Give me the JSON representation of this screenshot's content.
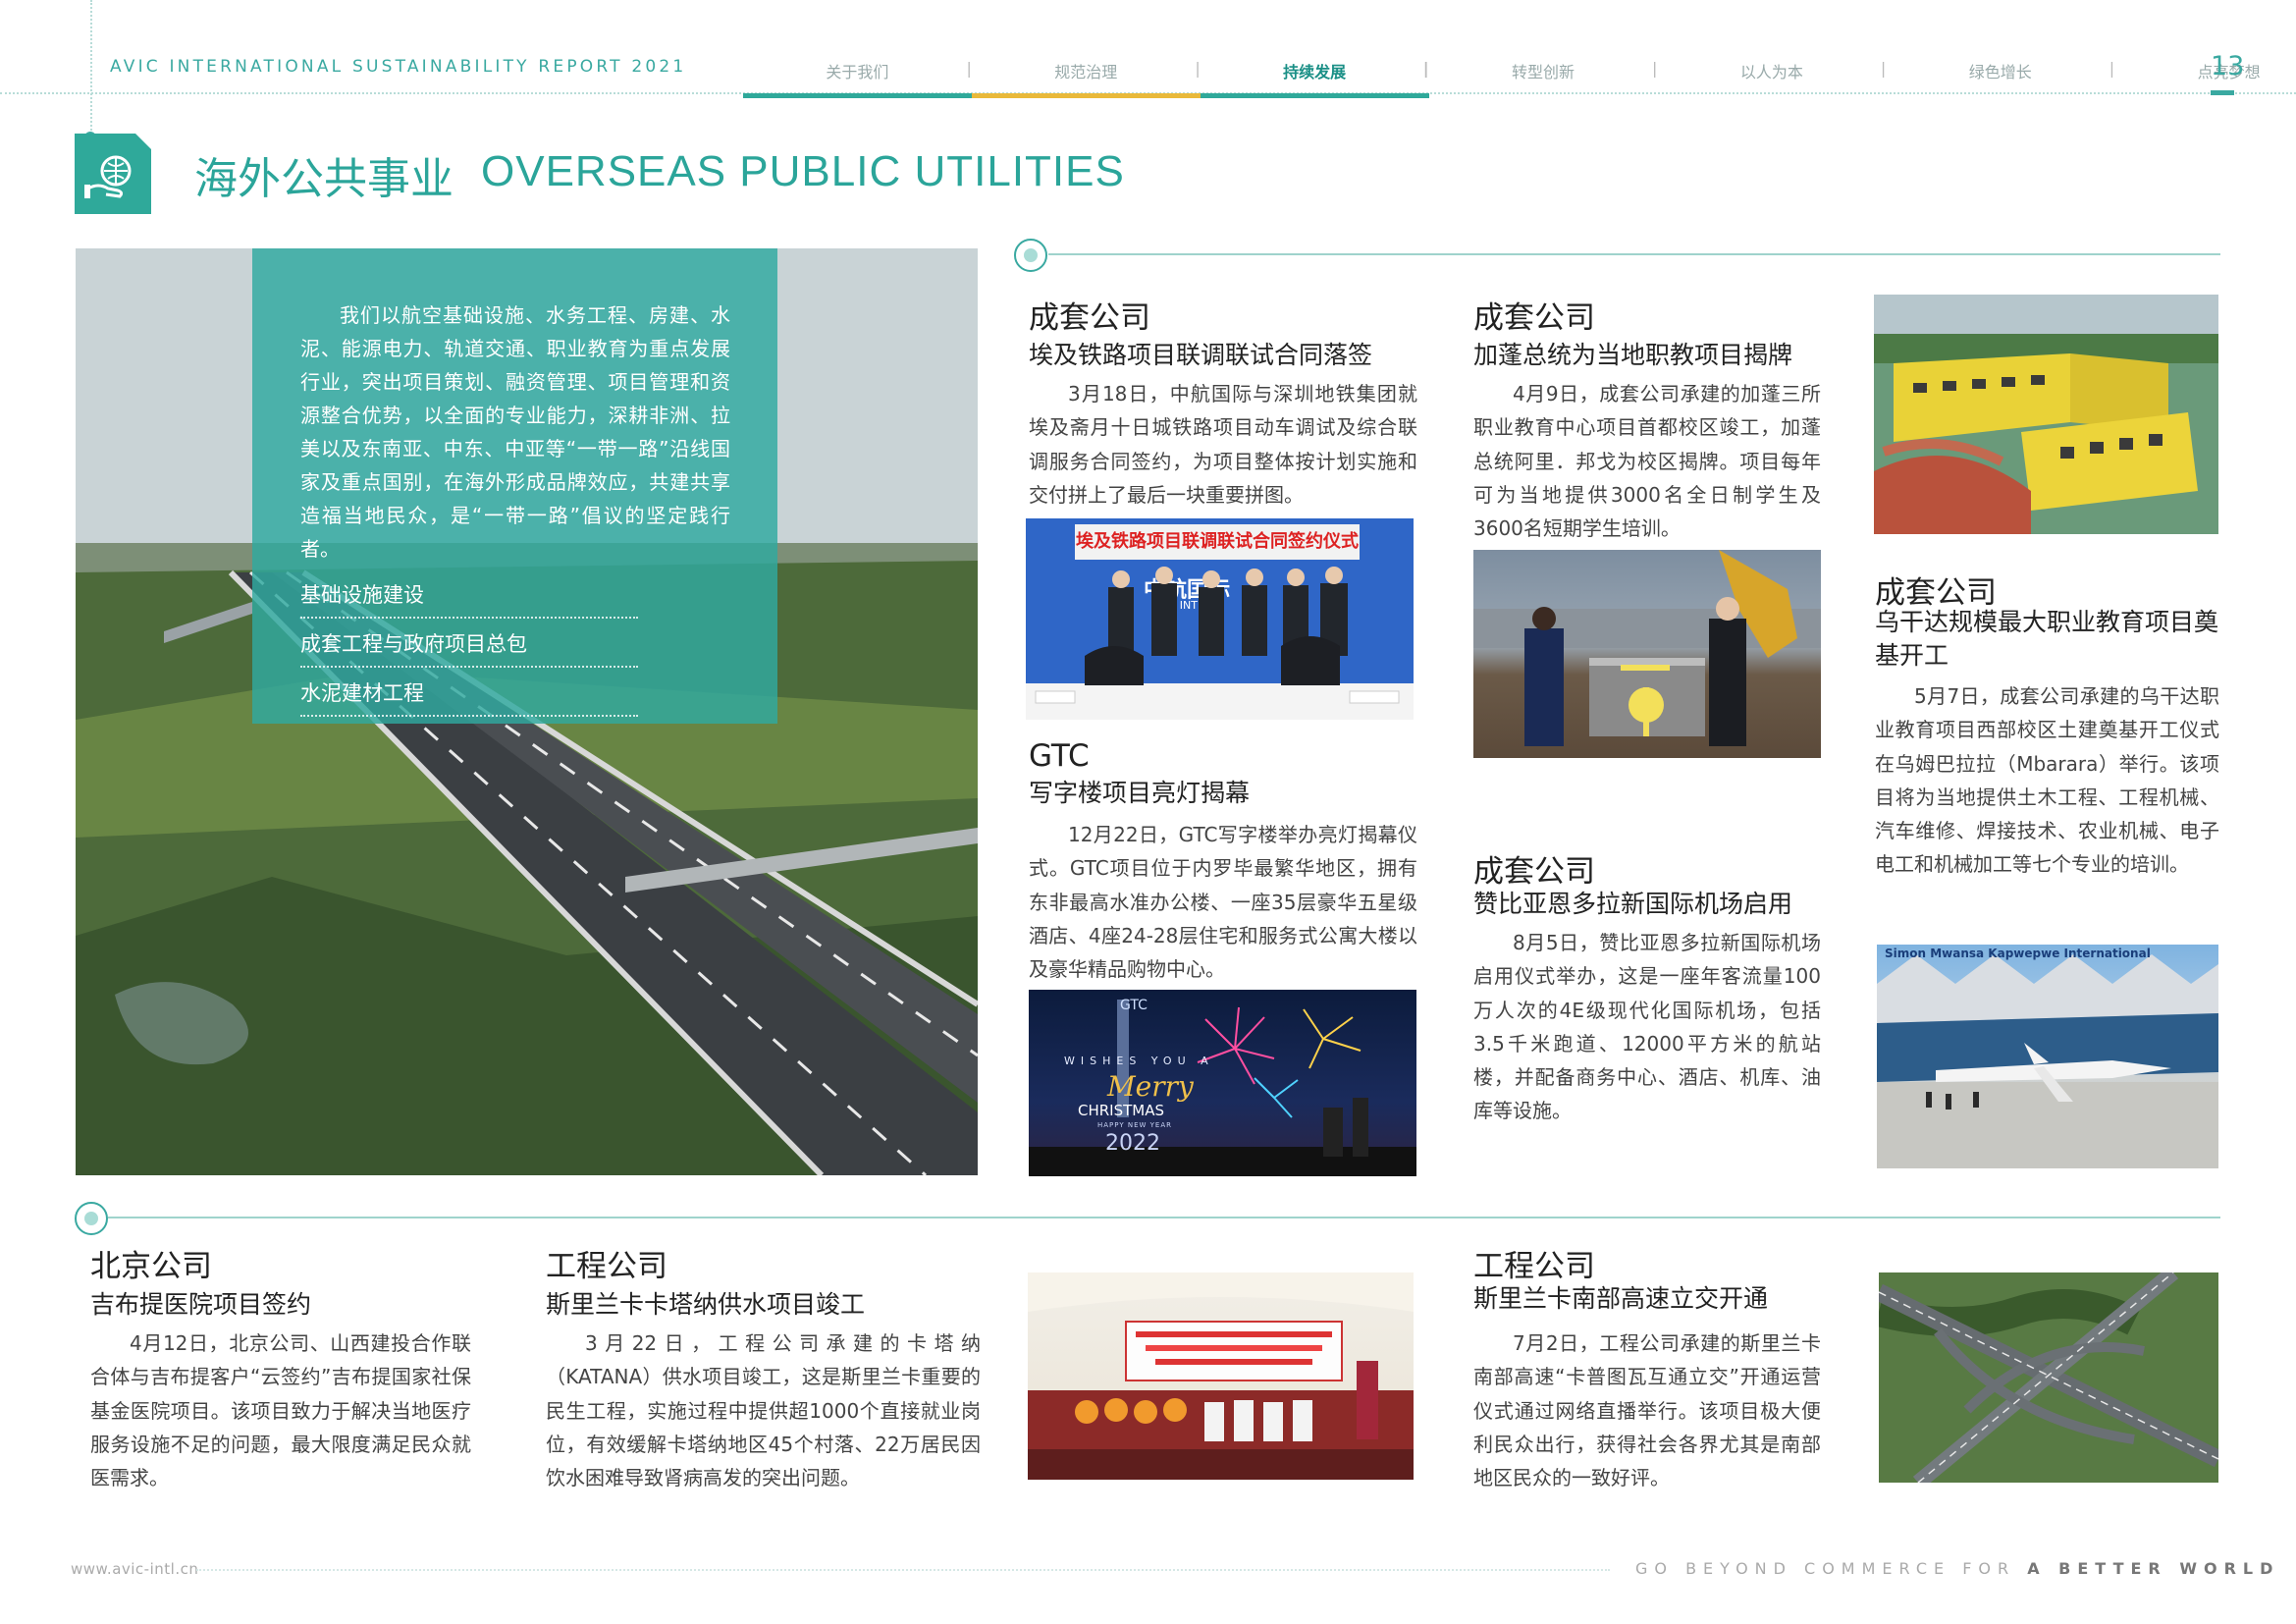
{
  "header": {
    "report_title": "AVIC INTERNATIONAL SUSTAINABILITY  REPORT 2021",
    "page_number": "13",
    "nav": [
      {
        "label": "关于我们",
        "active": false,
        "bar": "#2fa99a"
      },
      {
        "label": "规范治理",
        "active": false,
        "bar": "#e9b93a"
      },
      {
        "label": "持续发展",
        "active": true,
        "bar": "#2fa99a"
      },
      {
        "label": "转型创新",
        "active": false,
        "bar": ""
      },
      {
        "label": "以人为本",
        "active": false,
        "bar": ""
      },
      {
        "label": "绿色增长",
        "active": false,
        "bar": ""
      },
      {
        "label": "点亮梦想",
        "active": false,
        "bar": ""
      }
    ]
  },
  "section": {
    "title_cn": "海外公共事业",
    "title_en": "OVERSEAS PUBLIC UTILITIES",
    "icon": "globe-hand-icon"
  },
  "hero": {
    "text": "我们以航空基础设施、水务工程、房建、水泥、能源电力、轨道交通、职业教育为重点发展行业，突出项目策划、融资管理、项目管理和资源整合优势，以全面的专业能力，深耕非洲、拉美以及东南亚、中东、中亚等“一带一路”沿线国家及重点国别，在海外形成品牌效应，共建共享造福当地民众，是“一带一路”倡议的坚定践行者。",
    "links": [
      "基础设施建设",
      "成套工程与政府项目总包",
      "水泥建材工程"
    ]
  },
  "articles": {
    "egypt": {
      "company": "成套公司",
      "title": "埃及铁路项目联调联试合同落签",
      "body": "3月18日，中航国际与深圳地铁集团就埃及斋月十日城铁路项目动车调试及综合联调服务合同签约，为项目整体按计划实施和交付拼上了最后一块重要拼图。",
      "photo_banner": "埃及铁路项目联调联试合同签约仪式",
      "photo_logo": "中航国际",
      "photo_logo_en": "AVIC INTL"
    },
    "gtc": {
      "company": "GTC",
      "title": "写字楼项目亮灯揭幕",
      "body": "12月22日，GTC写字楼举办亮灯揭幕仪式。GTC项目位于内罗毕最繁华地区，拥有东非最高水准办公楼、一座35层豪华五星级酒店、4座24-28层住宅和服务式公寓大楼以及豪华精品购物中心。",
      "photo_brand": "GTC",
      "photo_wishes": "WISHES YOU A",
      "photo_merry": "Merry",
      "photo_christmas": "CHRISTMAS",
      "photo_newyear": "HAPPY NEW YEAR",
      "photo_year": "2022"
    },
    "gabon": {
      "company": "成套公司",
      "title": "加蓬总统为当地职教项目揭牌",
      "body": "4月9日，成套公司承建的加蓬三所职业教育中心项目首都校区竣工，加蓬总统阿里．邦戈为校区揭牌。项目每年可为当地提供3000名全日制学生及3600名短期学生培训。"
    },
    "zambia": {
      "company": "成套公司",
      "title": "赞比亚恩多拉新国际机场启用",
      "body": "8月5日，赞比亚恩多拉新国际机场启用仪式举办，这是一座年客流量100万人次的4E级现代化国际机场，包括3.5千米跑道、12000平方米的航站楼，并配备商务中心、酒店、机库、油库等设施。",
      "photo_sign": "Simon Mwansa Kapwepwe International"
    },
    "uganda": {
      "company": "成套公司",
      "title": "乌干达规模最大职业教育项目奠基开工",
      "body": "5月7日，成套公司承建的乌干达职业教育项目西部校区土建奠基开工仪式在乌姆巴拉拉（Mbarara）举行。该项目将为当地提供土木工程、工程机械、汽车维修、焊接技术、农业机械、电子电工和机械加工等七个专业的培训。"
    },
    "kiribati": {
      "company": "北京公司",
      "title": "吉布提医院项目签约",
      "body": "4月12日，北京公司、山西建投合作联合体与吉布提客户“云签约”吉布提国家社保基金医院项目。该项目致力于解决当地医疗服务设施不足的问题，最大限度满足民众就医需求。"
    },
    "katana": {
      "company": "工程公司",
      "title": "斯里兰卡卡塔纳供水项目竣工",
      "body": "3月22日，工程公司承建的卡塔纳（KATANA）供水项目竣工，这是斯里兰卡重要的民生工程，实施过程中提供超1000个直接就业岗位，有效缓解卡塔纳地区45个村落、22万居民因饮水困难导致肾病高发的突出问题。"
    },
    "expressway": {
      "company": "工程公司",
      "title": "斯里兰卡南部高速立交开通",
      "body": "7月2日，工程公司承建的斯里兰卡南部高速“卡普图瓦互通立交”开通运营仪式通过网络直播举行。该项目极大便利民众出行，获得社会各界尤其是南部地区民众的一致好评。"
    }
  },
  "footer": {
    "url": "www.avic-intl.cn",
    "slogan_light": "GO BEYOND COMMERCE FOR",
    "slogan_bold": "A BETTER WORLD"
  },
  "colors": {
    "accent": "#2fa99a",
    "accent_light": "#9fd3cc",
    "nav_yellow": "#e9b93a"
  }
}
